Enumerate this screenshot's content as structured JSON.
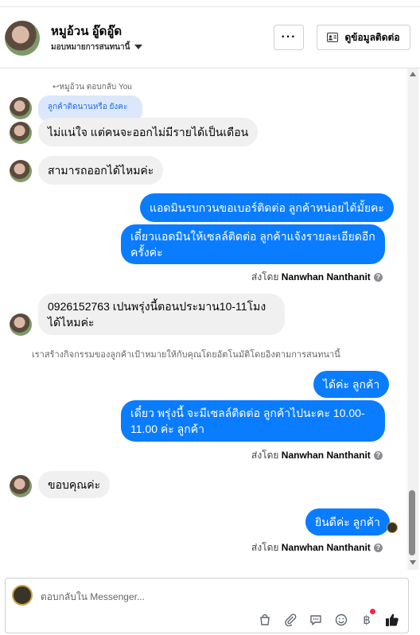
{
  "header": {
    "name": "หมูอ้วน อู๊ดอู๊ด",
    "assign_label": "มอบหมายการสนทนานี้",
    "more_label": "···",
    "contact_label": "ดูข้อมูลติดต่อ"
  },
  "thread": {
    "reply_label": "↩หมูอ้วน ตอบกลับ You",
    "reply_quote": "ลูกค้าติดนานหรือ ยังคะ",
    "system_note": "เราสร้างกิจกรรมของลูกค้าเป้าหมายให้กับคุณโดยอัตโนมัติโดยอิงตามการสนทนานี้",
    "messages": [
      {
        "direction": "in",
        "text": "ไม่แน่ใจ แต่คนจะออกไม่มีรายได้เป็นเดือน"
      },
      {
        "direction": "in",
        "text": "สามารถออกได้ไหมค่ะ"
      },
      {
        "direction": "out",
        "text": "แอดมินรบกวนขอเบอร์ติดต่อ ลูกค้าหน่อยได้มั้ยคะ"
      },
      {
        "direction": "out",
        "text": "เดี๋ยวแอดมินให้เซลล์ติดต่อ ลูกค้าแจ้งรายละเอียดอีกครั้งค่ะ"
      },
      {
        "direction": "in",
        "text": "0926152763 เปนพรุ่งนี้ตอนประมาน10-11โมงได้ไหมค่ะ"
      },
      {
        "direction": "out",
        "text": "ได้ค่ะ ลูกค้า"
      },
      {
        "direction": "out",
        "text": "เดี๋ยว พรุ่งนี้ จะมีเซลล์ติดต่อ ลูกค้าไปนะคะ 10.00-11.00 ค่ะ ลูกค้า"
      },
      {
        "direction": "in",
        "text": "ขอบคุณค่ะ"
      },
      {
        "direction": "out",
        "text": "ยินดีค่ะ ลูกค้า"
      }
    ],
    "sent_by_prefix": "ส่งโดย",
    "sent_by_name": "Nanwhan Nanthanit"
  },
  "composer": {
    "placeholder": "ตอบกลับใน Messenger...",
    "tools": [
      "bag-icon",
      "paperclip-icon",
      "chat-bubble-icon",
      "emoji-icon",
      "baht-icon",
      "thumbs-up-icon"
    ]
  },
  "colors": {
    "outgoing_bubble": "#0a7cff",
    "incoming_bubble": "#f0f0f0",
    "quote_bubble": "#dbe7fb"
  }
}
